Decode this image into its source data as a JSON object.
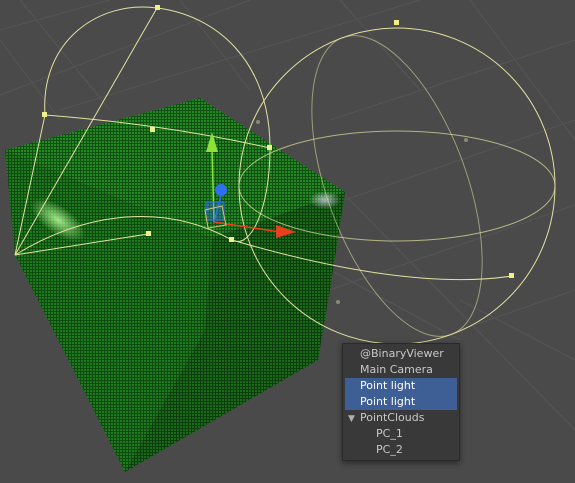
{
  "scene": {
    "background_color": "#4a4a4a",
    "grid_color": "#5a5a5a",
    "cube_color": "#1f7a1f",
    "cube_dark_color": "#125212",
    "gizmo_wire_color": "#e2e2a0",
    "axis_colors": {
      "x": "#e8401c",
      "y": "#8ee03a",
      "z": "#2d6ff0"
    },
    "icons": [
      "point-light-gizmo-icon",
      "translate-handle-icon"
    ]
  },
  "hierarchy": {
    "items": [
      {
        "label": "@BinaryViewer",
        "selected": false,
        "indent": 0
      },
      {
        "label": "Main Camera",
        "selected": false,
        "indent": 0
      },
      {
        "label": "Point light",
        "selected": true,
        "indent": 0
      },
      {
        "label": "Point light",
        "selected": true,
        "indent": 0
      },
      {
        "label": "PointClouds",
        "selected": false,
        "indent": 0,
        "expanded": true,
        "arrow": "▼"
      },
      {
        "label": "PC_1",
        "selected": false,
        "indent": 1
      },
      {
        "label": "PC_2",
        "selected": false,
        "indent": 1
      }
    ],
    "selection_color": "#3e5f96",
    "panel_color": "#393939"
  }
}
